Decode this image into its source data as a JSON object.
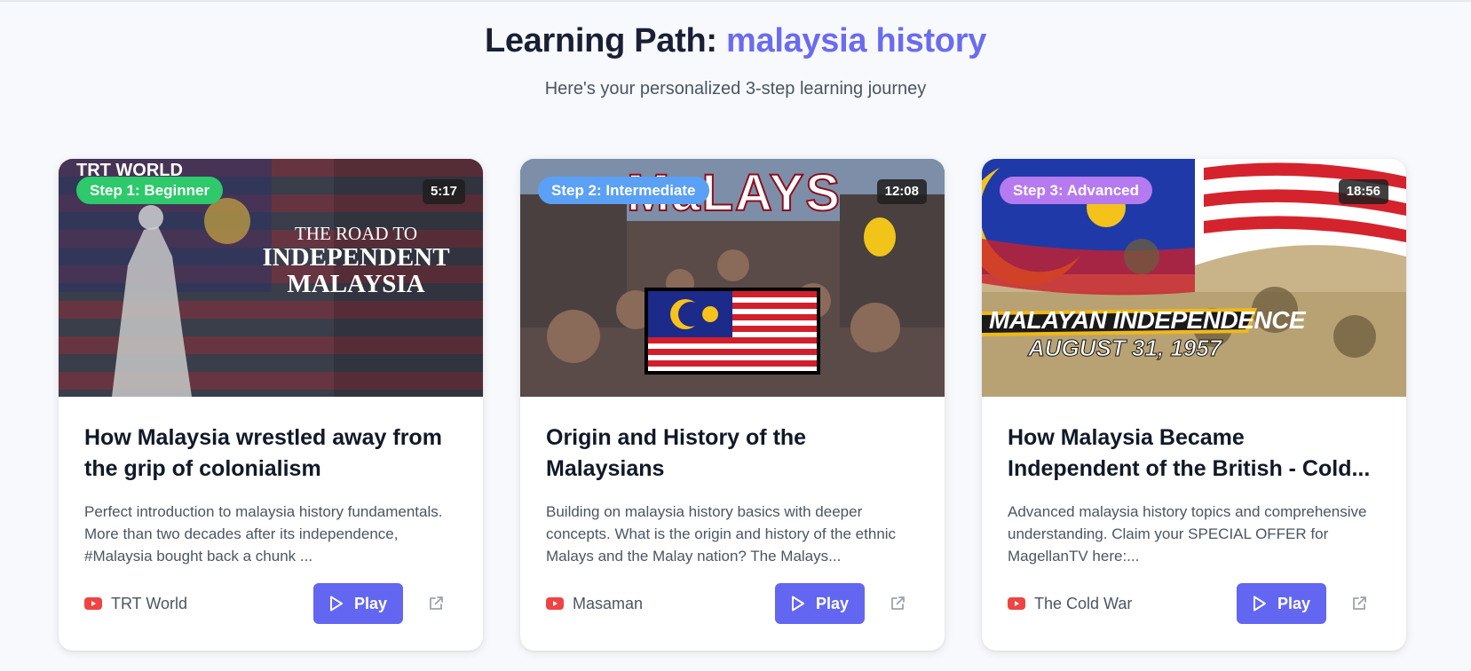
{
  "header": {
    "title_prefix": "Learning Path: ",
    "title_topic": "malaysia history",
    "subtitle": "Here's your personalized 3-step learning journey"
  },
  "colors": {
    "accent": "#6b6bf0",
    "beginner": "#2dc96b",
    "intermediate": "#5aa0f5",
    "advanced": "#b67af0",
    "play_button": "#6366f1",
    "youtube_red": "#ef4444"
  },
  "cards": [
    {
      "step_label": "Step 1: Beginner",
      "duration": "5:17",
      "thumbnail_text": {
        "brand": "TRT WORLD",
        "line1": "THE ROAD TO",
        "line2": "INDEPENDENT",
        "line3": "MALAYSIA"
      },
      "title": "How Malaysia wrestled away from the grip of colonialism",
      "description": "Perfect introduction to malaysia history fundamentals. More than two decades after its independence, #Malaysia bought back a chunk ...",
      "channel": "TRT World",
      "channel_icon": "youtube-icon",
      "play_label": "Play",
      "external_icon": "external-link-icon"
    },
    {
      "step_label": "Step 2: Intermediate",
      "duration": "12:08",
      "thumbnail_text": {
        "headline": "MaLAYS"
      },
      "title": "Origin and History of the Malaysians",
      "description": "Building on malaysia history basics with deeper concepts. What is the origin and history of the ethnic Malays and the Malay nation? The Malays...",
      "channel": "Masaman",
      "channel_icon": "youtube-icon",
      "play_label": "Play",
      "external_icon": "external-link-icon"
    },
    {
      "step_label": "Step 3: Advanced",
      "duration": "18:56",
      "thumbnail_text": {
        "line1": "MALAYAN INDEPENDENCE",
        "line2": "AUGUST 31, 1957"
      },
      "title": "How Malaysia Became Independent of the British - Cold...",
      "description": "Advanced malaysia history topics and comprehensive understanding. Claim your SPECIAL OFFER for MagellanTV here:...",
      "channel": "The Cold War",
      "channel_icon": "youtube-icon",
      "play_label": "Play",
      "external_icon": "external-link-icon"
    }
  ]
}
